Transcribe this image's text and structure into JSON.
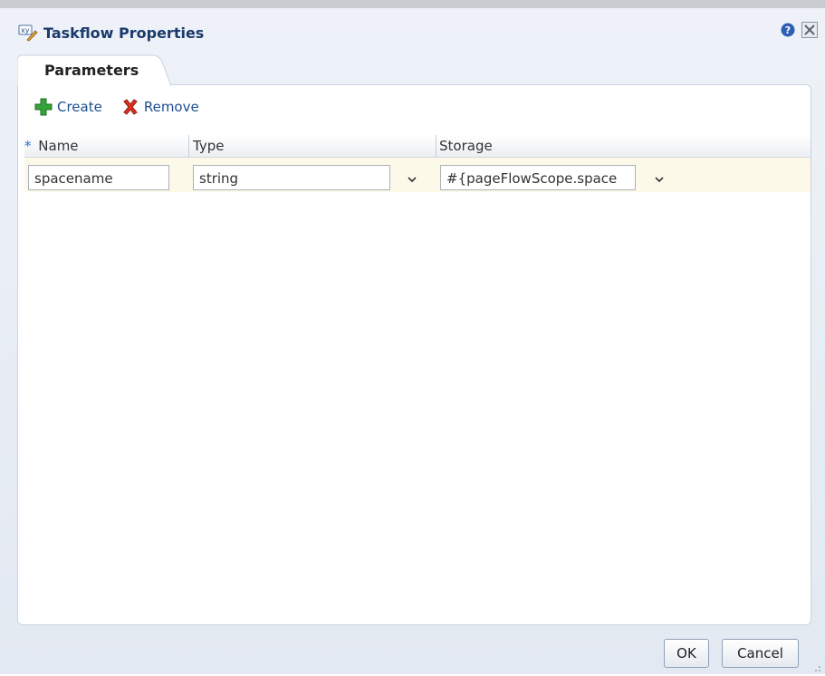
{
  "dialog": {
    "title": "Taskflow Properties",
    "title_icon": "xy-edit-icon",
    "help_icon": "help-icon",
    "close_icon": "close-icon"
  },
  "tabs": [
    {
      "label": "Parameters",
      "selected": true
    }
  ],
  "toolbar": {
    "create_label": "Create",
    "remove_label": "Remove"
  },
  "table": {
    "required_marker": "*",
    "columns": [
      "Name",
      "Type",
      "Storage"
    ],
    "rows": [
      {
        "name": "spacename",
        "type": "string",
        "storage": "#{pageFlowScope.space"
      }
    ]
  },
  "footer": {
    "ok_label": "OK",
    "cancel_label": "Cancel"
  },
  "colors": {
    "title": "#1a3a6b",
    "link": "#1d4f91",
    "row_highlight": "#fdf9e9"
  }
}
